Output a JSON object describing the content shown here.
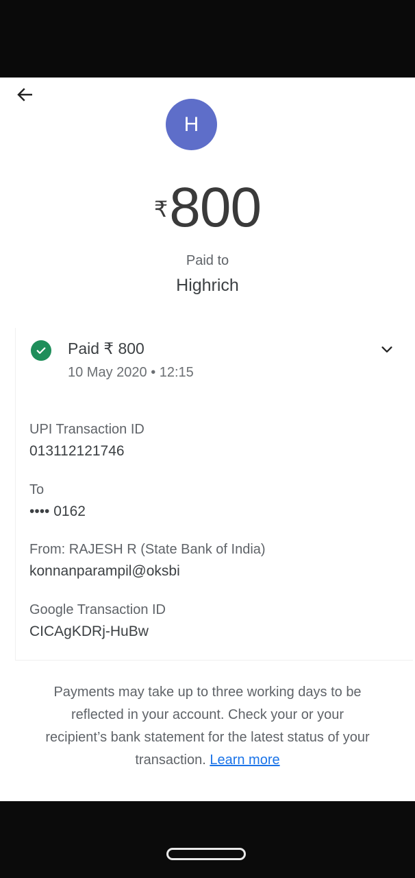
{
  "header": {
    "back_icon": "arrow-left-icon"
  },
  "payee": {
    "avatar_initial": "H",
    "avatar_color": "#5e6ec9",
    "currency_symbol": "₹",
    "amount": "800",
    "paid_to_label": "Paid to",
    "name": "Highrich"
  },
  "status": {
    "icon": "check-circle-icon",
    "color": "#1e8e5a",
    "text": "Paid ₹ 800",
    "datetime": "10 May 2020 • 12:15",
    "expand_icon": "chevron-down-icon"
  },
  "details": [
    {
      "label": "UPI Transaction ID",
      "value": "013112121746"
    },
    {
      "label": "To",
      "value": "•••• 0162"
    },
    {
      "label": "From: RAJESH  R (State Bank of India)",
      "value": "konnanparampil@oksbi"
    },
    {
      "label": "Google Transaction ID",
      "value": "CICAgKDRj-HuBw"
    }
  ],
  "footer": {
    "note": "Payments may take up to three working days to be reflected in your account. Check your or your recipient’s bank statement for the latest status of your transaction.",
    "link": "Learn more",
    "link_color": "#1a73e8"
  }
}
